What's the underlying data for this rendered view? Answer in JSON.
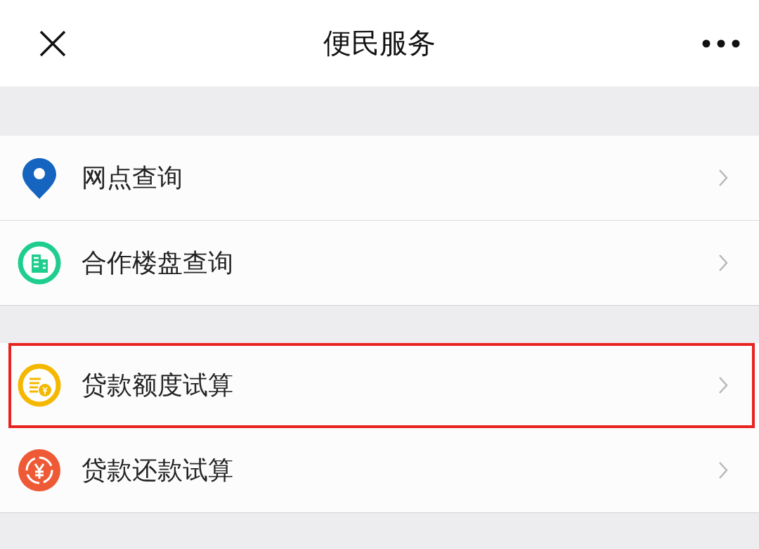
{
  "header": {
    "title": "便民服务"
  },
  "groups": [
    {
      "items": [
        {
          "kind": "pin",
          "label": "网点查询",
          "highlighted": false
        },
        {
          "kind": "building",
          "label": "合作楼盘查询",
          "highlighted": false
        }
      ]
    },
    {
      "items": [
        {
          "kind": "coins",
          "label": "贷款额度试算",
          "highlighted": true
        },
        {
          "kind": "exchange",
          "label": "贷款还款试算",
          "highlighted": false
        }
      ]
    }
  ]
}
